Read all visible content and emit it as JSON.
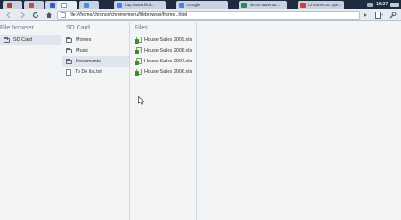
{
  "tabs": [
    {
      "title": "",
      "favicon_color": "#c0392b",
      "pinned": true
    },
    {
      "title": "",
      "favicon_color": "#d14836",
      "pinned": true
    },
    {
      "title": "",
      "favicon_color": "#2f5ec4",
      "pinned": true
    },
    {
      "title": "",
      "favicon_color": "#e9eef5",
      "pinned": true,
      "active": true
    },
    {
      "title": "",
      "favicon_color": "#4a90d9",
      "pinned": true
    },
    {
      "title": "http://www.flick...",
      "favicon_color": "#3b82f6"
    },
    {
      "title": "Google",
      "favicon_color": "#4285f4"
    },
    {
      "title": "Nico's adventur...",
      "favicon_color": "#2e8b57"
    },
    {
      "title": "Chrome OS Ope...",
      "favicon_color": "#d63a3a"
    }
  ],
  "status": {
    "clock": "16:27"
  },
  "toolbar": {
    "back_icon": "back-arrow-icon",
    "forward_icon": "forward-arrow-icon",
    "reload_icon": "reload-icon",
    "home_icon": "home-icon",
    "url": "file:///home/chronos/chromemenu/filebrowser/frame1.html"
  },
  "file_browser": {
    "title": "File browser",
    "items": [
      {
        "label": "SD Card",
        "selected": true
      }
    ]
  },
  "sd_card": {
    "title": "SD Card",
    "items": [
      {
        "label": "Movies",
        "type": "folder"
      },
      {
        "label": "Music",
        "type": "folder"
      },
      {
        "label": "Documents",
        "type": "folder",
        "selected": true
      },
      {
        "label": "To Do list.txt",
        "type": "file"
      }
    ]
  },
  "files": {
    "title": "Files",
    "items": [
      {
        "label": "House Sales 2009.xls"
      },
      {
        "label": "House Sales 2008.xls"
      },
      {
        "label": "House Sales 2007.xls"
      },
      {
        "label": "House Sales 2006.xls"
      }
    ]
  },
  "colors": {
    "xls_green": "#3e8b2b",
    "selection": "#dfe5ec",
    "chrome_dark": "#1f2b3f"
  }
}
